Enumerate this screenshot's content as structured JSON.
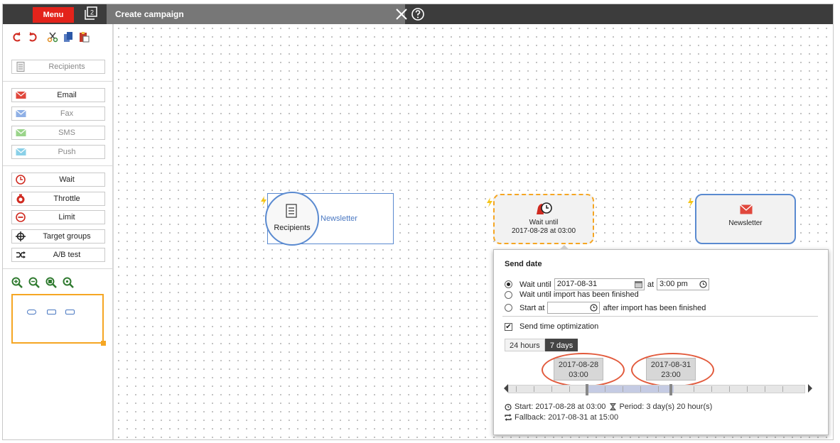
{
  "topbar": {
    "menu_label": "Menu",
    "window_count": "2",
    "tab_title": "Create campaign"
  },
  "palette": {
    "items": [
      {
        "label": "Recipients",
        "icon": "list-document-icon",
        "enabled": false
      },
      {
        "label": "Email",
        "icon": "envelope-icon",
        "enabled": true
      },
      {
        "label": "Fax",
        "icon": "envelope-icon",
        "enabled": false
      },
      {
        "label": "SMS",
        "icon": "envelope-icon",
        "enabled": false
      },
      {
        "label": "Push",
        "icon": "envelope-icon",
        "enabled": false
      },
      {
        "label": "Wait",
        "icon": "clock-icon",
        "enabled": true
      },
      {
        "label": "Throttle",
        "icon": "throttle-icon",
        "enabled": true
      },
      {
        "label": "Limit",
        "icon": "limit-icon",
        "enabled": true
      },
      {
        "label": "Target groups",
        "icon": "crosshair-icon",
        "enabled": true
      },
      {
        "label": "A/B test",
        "icon": "shuffle-icon",
        "enabled": true
      }
    ]
  },
  "nodes": {
    "recipients_label": "Recipients",
    "recipients_link": "Newsletter",
    "wait_line1": "Wait until",
    "wait_line2": "2017-08-28 at 03:00",
    "newsletter_label": "Newsletter"
  },
  "popup": {
    "title": "Send date",
    "wait_until_label": "Wait until",
    "wait_until_date": "2017-08-31",
    "at_label": "at",
    "time_value": "3:00 pm",
    "wait_import_label": "Wait until import has been finished",
    "start_at_label": "Start at",
    "start_at_value": "",
    "after_import_label": "after import has been finished",
    "sto_label": "Send time optimization",
    "tab_24h": "24 hours",
    "tab_7d": "7 days",
    "range_start_date": "2017-08-28",
    "range_start_time": "03:00",
    "range_end_date": "2017-08-31",
    "range_end_time": "23:00",
    "start_text": "Start: 2017-08-28 at 03:00",
    "period_text": "Period: 3 day(s) 20 hour(s)",
    "fallback_text": "Fallback: 2017-08-31 at 15:00"
  },
  "colors": {
    "accent_red": "#e3231b",
    "node_blue": "#5a8ad0",
    "highlight_orange": "#f5a623"
  }
}
